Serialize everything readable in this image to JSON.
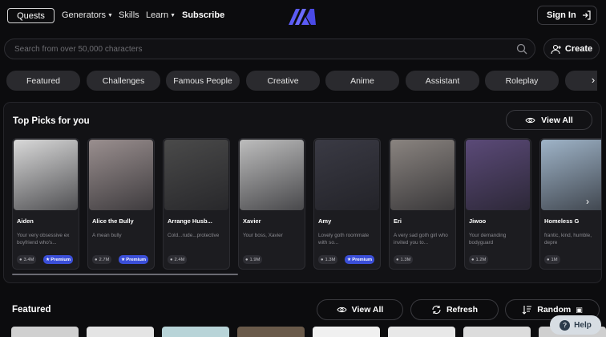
{
  "nav": {
    "quests": "Quests",
    "generators": "Generators",
    "skills": "Skills",
    "learn": "Learn",
    "subscribe": "Subscribe",
    "sign_in": "Sign In"
  },
  "search": {
    "placeholder": "Search from over 50,000 characters"
  },
  "create_label": "Create",
  "categories": [
    "Featured",
    "Challenges",
    "Famous People",
    "Creative",
    "Anime",
    "Assistant",
    "Roleplay"
  ],
  "top_picks": {
    "title": "Top Picks for you",
    "view_all": "View All",
    "cards": [
      {
        "name": "Aiden",
        "desc": "Your very obsessive ex boyfriend who's...",
        "stat": "3.4M",
        "premium": "Premium",
        "tone": "#d9d9d9"
      },
      {
        "name": "Alice the Bully",
        "desc": "A mean bully",
        "stat": "2.7M",
        "premium": "Premium",
        "tone": "#9a8f8f"
      },
      {
        "name": "Arrange Husb...",
        "desc": "Cold...rude...protective",
        "stat": "2.4M",
        "premium": "",
        "tone": "#4a4a4a"
      },
      {
        "name": "Xavier",
        "desc": "Your boss, Xavier",
        "stat": "1.9M",
        "premium": "",
        "tone": "#bdbdbd"
      },
      {
        "name": "Amy",
        "desc": "Lovely goth roommate with so...",
        "stat": "1.3M",
        "premium": "Premium",
        "tone": "#3a3a44"
      },
      {
        "name": "Eri",
        "desc": "A very sad goth girl who invited you to...",
        "stat": "1.3M",
        "premium": "",
        "tone": "#8a8480"
      },
      {
        "name": "Jiwoo",
        "desc": "Your demanding bodyguard",
        "stat": "1.2M",
        "premium": "",
        "tone": "#5b4a78"
      },
      {
        "name": "Homeless G",
        "desc": "frantic, kind, humble, depre",
        "stat": "1M",
        "premium": "",
        "tone": "#9fb4c8"
      }
    ]
  },
  "featured": {
    "title": "Featured",
    "view_all": "View All",
    "refresh": "Refresh",
    "random": "Random",
    "thumbs": [
      "#d0d0d0",
      "#e4e4e4",
      "#b8d4d8",
      "#6a5a4a",
      "#f0f0f0",
      "#e8e8e8",
      "#dcdcdc",
      "#cfcfcf"
    ]
  },
  "help_label": "Help",
  "colors": {
    "background": "#0c0c0e",
    "panel": "#121215",
    "pill": "#2a2a2e",
    "accent": "#5b5bf5",
    "premium": "#3b4fd8"
  }
}
